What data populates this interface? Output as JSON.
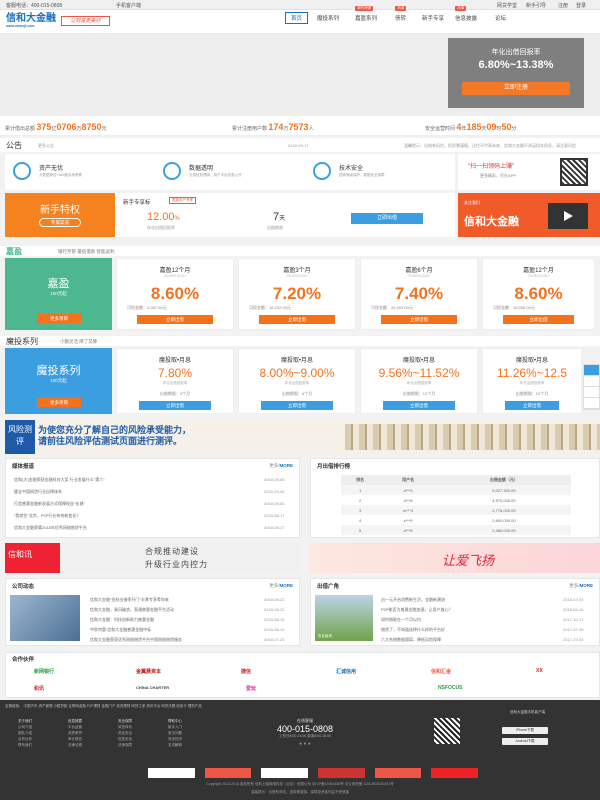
{
  "topbar": {
    "hotline": "客服电话：400-015-0808",
    "app": "手机客户端",
    "links": [
      "网贷学堂",
      "新手引导",
      "注册",
      "登录"
    ]
  },
  "header": {
    "logo": "信和大金融",
    "logo_sub": "www.xinhejf.com",
    "slogan": "让财富更美好"
  },
  "nav": [
    {
      "label": "首页",
      "active": true
    },
    {
      "label": "魔投系列",
      "badge": ""
    },
    {
      "label": "嘉盈系列",
      "badge": "限时特惠"
    },
    {
      "label": "债转",
      "badge": "热卖"
    },
    {
      "label": "新手专享",
      "badge": ""
    },
    {
      "label": "信息披露",
      "badge": "热卖"
    },
    {
      "label": "论坛",
      "badge": ""
    }
  ],
  "banner": {
    "title": "年化出借回报率",
    "rate": "6.80%~13.38%",
    "button": "立即注册"
  },
  "stats": [
    {
      "label": "累计借出总额",
      "v": "375",
      "u1": "亿",
      "v2": "0706",
      "u2": "万",
      "v3": "8750",
      "u3": "元"
    },
    {
      "label": "累计注册用户数",
      "v": "174",
      "u1": "万",
      "v2": "7573",
      "u2": "人"
    },
    {
      "label": "安全运营时间",
      "v": "4",
      "u1": "年",
      "v2": "185",
      "u2": "天",
      "v3": "09",
      "u3": "时",
      "v4": "50",
      "u4": "分"
    }
  ],
  "notice": {
    "title": "公告",
    "more": "更多公告",
    "date": "2018-09-17",
    "text": "温馨提示：出借有风险，投资需谨慎，过往不代表未来，信和大金融不承诺保本保息，请注意风险"
  },
  "features": [
    {
      "t": "资产无忧",
      "s": "大数据风控+360度实地考察"
    },
    {
      "t": "数据透明",
      "s": "交易信息透明，用户平台信息公开"
    },
    {
      "t": "技术安全",
      "s": "国家等级保护，数据安全保障"
    }
  ],
  "qr": {
    "t": "\"扫一扫领码上赚\"",
    "s": "更多精彩，尽在APP"
  },
  "novice": {
    "title": "新手特权",
    "badge": "专属渠道",
    "product": "新手专享标",
    "tag": "限新用户专享",
    "rate": "12.00",
    "rate_unit": "%",
    "rate_label": "年化出借回报率",
    "term": "7",
    "term_unit": "天",
    "term_label": "出借期限",
    "button": "立即出借"
  },
  "ad1": {
    "brand": "信和大金融",
    "s": "关注我们"
  },
  "jiaying": {
    "title": "嘉盈",
    "tabs": "银行存管  最低借款  智能返利",
    "big": {
      "t": "嘉盈",
      "s": "100元起",
      "btn": "更多项目"
    },
    "cards": [
      {
        "n": "嘉盈12个月",
        "id": "2018091625J",
        "r": "8.60%",
        "a": "可投金额：4,287.00元",
        "btn": "立即出借"
      },
      {
        "n": "嘉盈3个月",
        "id": "2018091003C",
        "r": "7.20%",
        "a": "可投金额：16,232.00元",
        "btn": "立即出借"
      },
      {
        "n": "嘉盈6个月",
        "id": "2018091334E",
        "r": "7.40%",
        "a": "可投金额：28,493.00元",
        "btn": "立即出借"
      },
      {
        "n": "嘉盈12个月",
        "id": "2018091425J",
        "r": "8.60%",
        "a": "可投金额：15,556.00元",
        "btn": "立即出借"
      }
    ]
  },
  "motou": {
    "title": "魔投系列",
    "tabs": "小额灵活  降了又降",
    "big": {
      "t": "魔投系列",
      "s": "100元起",
      "btn": "更多项目"
    },
    "cards": [
      {
        "n": "魔投取•月息",
        "r": "7.80%",
        "l": "年化出借回报率",
        "a": "出借期限：3个月",
        "btn": "立即出借"
      },
      {
        "n": "魔投取•月息",
        "r": "8.00%~9.00%",
        "l": "年化出借回报率",
        "a": "出借期限：6个月",
        "btn": "立即出借"
      },
      {
        "n": "魔投取•月息",
        "r": "9.56%~11.52%",
        "l": "年化出借回报率",
        "a": "出借期限：12个月",
        "btn": "立即出借"
      },
      {
        "n": "魔投取•月息",
        "r": "11.26%~12.5",
        "l": "年化出借回报率",
        "a": "出借期限：24个月",
        "btn": "立即出借"
      }
    ]
  },
  "risk": {
    "label": "风险测评",
    "line1": "为使您充分了解自己的风险承受能力，",
    "line2": "请前往风险评估测试页面进行测评。"
  },
  "media": {
    "title": "媒体报道",
    "more": "更多",
    "more2": "MORE",
    "items": [
      {
        "t": "信和(大)金融荣获金融科技大奖 行业发展什么\"第六\"",
        "d": "2018-09-08"
      },
      {
        "t": "健全中国网贷行业自律体系",
        "d": "2018-09-06"
      },
      {
        "t": "打造普惠金融新发展方式保障权益\"长城\"",
        "d": "2018-09-06"
      },
      {
        "t": "\"我就住\"北京，P2P行业有何新变化？",
        "d": "2018-08-17"
      },
      {
        "t": "信和大金融荣膺2018年优秀网络借贷平台",
        "d": "2018-08-17"
      }
    ]
  },
  "ranking": {
    "title": "月出借排行榜",
    "cols": [
      "排名",
      "用户名",
      "出借金额（元）"
    ],
    "rows": [
      [
        "1",
        "d***3",
        "5,027,300.00"
      ],
      [
        "2",
        "d***6",
        "4,570,000.00"
      ],
      [
        "3",
        "m***3",
        "2,776,000.00"
      ],
      [
        "4",
        "z***9",
        "2,600,000.00"
      ],
      [
        "5",
        "d***8",
        "2,460,000.00"
      ]
    ]
  },
  "ad2": {
    "l": "信和讯",
    "t1": "合规推动建设",
    "t2": "升级行业内控力"
  },
  "ad3": {
    "t": "让爱飞扬"
  },
  "dynamics": {
    "title": "公司动态",
    "more": "更多",
    "more2": "MORE",
    "items": [
      {
        "t": "信和大金融\"金秋出借季开门\"丰厚专享等你来",
        "d": "2018-08-22"
      },
      {
        "t": "信和大金融，乘风破浪，直通普惠金融平台活动",
        "d": "2018-08-22"
      },
      {
        "t": "信和大金融：科技创新助力普惠金融",
        "d": "2018-08-15"
      },
      {
        "t": "中秋特惠 信和大金融普惠金融中标",
        "d": "2018-08-13"
      },
      {
        "t": "信和大金融荣获优秀网络借贷平台中国网络借贷服务",
        "d": "2018-07-23"
      }
    ]
  },
  "square": {
    "title": "出借广角",
    "more": "更多",
    "more2": "MORE",
    "caption": "农业板块",
    "items": [
      {
        "t": "出一元开启消费新生活，金融新潮流",
        "d": "2018-07-04"
      },
      {
        "t": "P2P能否为普惠金融加速，让用户放心？",
        "d": "2018-03-16"
      },
      {
        "t": "如何借款在一个月以内",
        "d": "2017-10-17"
      },
      {
        "t": "借贷了，不知道选择什么样的平台好",
        "d": "2017-07-05"
      },
      {
        "t": "六大系统数据隔离，降低风险保障",
        "d": "2017-07-04"
      }
    ]
  },
  "partners": {
    "title": "合作伙伴",
    "row1": [
      "新网银行",
      "金翼晨资本",
      "捷信",
      "汇诚信用",
      "信和汇金",
      "XX"
    ],
    "row2": [
      "和讯",
      "CHINA CHARTER",
      "爱玩",
      "",
      "NSFOCUS",
      ""
    ]
  },
  "footer": {
    "links": "友情链接：  中国汽车  资产管理  小额贷款  互联网金融  P2P理财  金融门户  投资理财  网贷之家  资讯平台  网贷天眼  信用卡  理财产品",
    "cols": [
      {
        "h": "关于我们",
        "i": [
          "公司介绍",
          "团队介绍",
          "合作伙伴",
          "联系我们"
        ]
      },
      {
        "h": "信息披露",
        "i": [
          "平台运营",
          "资质荣誉",
          "审计报告",
          "法律法规"
        ]
      },
      {
        "h": "安全保障",
        "i": [
          "风控体系",
          "资金安全",
          "信息安全",
          "法律保障"
        ]
      },
      {
        "h": "帮助中心",
        "i": [
          "新手入门",
          "常见问题",
          "安全知识",
          "名词解释"
        ]
      }
    ],
    "hot_label": "在线客服",
    "phone": "400-015-0808",
    "hours": "工作日8:00-21:00 周末8:00-18:00",
    "app_title": "信和大金融手机客户端",
    "iphone": "iPhone下载",
    "android": "Android下载",
    "copyright": "Copyright 2014-2018 版权所有 信和上融网络科技（北京）有限公司  京ICP备15064458号  京公网安备 11010502030451号",
    "warning": "温馨提示：出借有风险，选择需谨慎。保障投资者利益不受侵害"
  }
}
